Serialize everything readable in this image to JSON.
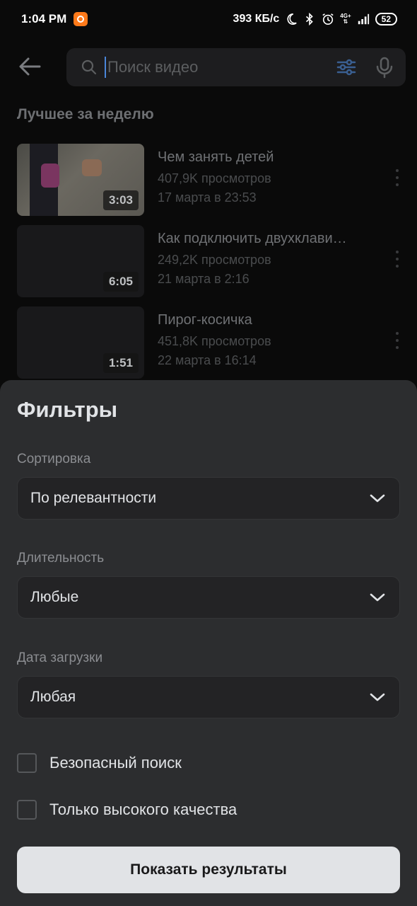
{
  "status_bar": {
    "time": "1:04 PM",
    "net_speed": "393 КБ/с",
    "network_type": "4G+",
    "battery": "52"
  },
  "search": {
    "placeholder": "Поиск видео",
    "value": ""
  },
  "section": {
    "title": "Лучшее за неделю"
  },
  "videos": [
    {
      "title": "Чем занять детей",
      "views": "407,9K просмотров",
      "date": "17 марта в 23:53",
      "duration": "3:03"
    },
    {
      "title": "Как подключить двухклави…",
      "views": "249,2K просмотров",
      "date": "21 марта в 2:16",
      "duration": "6:05"
    },
    {
      "title": "Пирог-косичка",
      "views": "451,8K просмотров",
      "date": "22 марта в 16:14",
      "duration": "1:51"
    }
  ],
  "filters": {
    "title": "Фильтры",
    "sort": {
      "label": "Сортировка",
      "value": "По релевантности"
    },
    "duration": {
      "label": "Длительность",
      "value": "Любые"
    },
    "upload_date": {
      "label": "Дата загрузки",
      "value": "Любая"
    },
    "safe_search": {
      "label": "Безопасный поиск",
      "checked": false
    },
    "hq_only": {
      "label": "Только высокого качества",
      "checked": false
    },
    "submit_label": "Показать результаты"
  },
  "colors": {
    "sheet_bg": "#2c2d2f",
    "accent": "#4a86d9",
    "button_bg": "#e1e3e6"
  }
}
